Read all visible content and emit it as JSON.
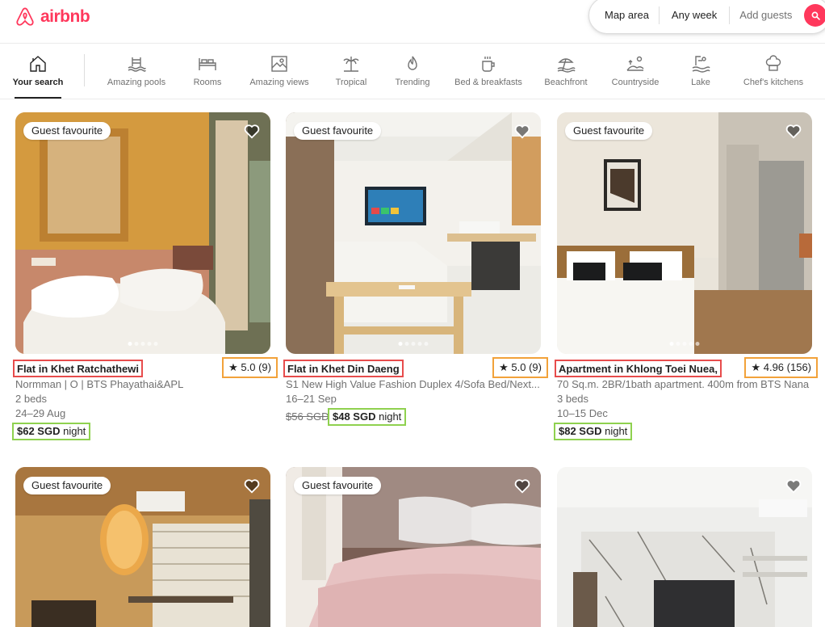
{
  "header": {
    "logo_text": "airbnb",
    "search": {
      "map_label": "Map area",
      "week_label": "Any week",
      "guests_label": "Add guests"
    }
  },
  "categories": [
    {
      "label": "Your search",
      "icon": "home-icon",
      "active": true
    },
    {
      "label": "Amazing pools",
      "icon": "pool-icon",
      "active": false
    },
    {
      "label": "Rooms",
      "icon": "bed-icon",
      "active": false
    },
    {
      "label": "Amazing views",
      "icon": "view-icon",
      "active": false
    },
    {
      "label": "Tropical",
      "icon": "palm-icon",
      "active": false
    },
    {
      "label": "Trending",
      "icon": "flame-icon",
      "active": false
    },
    {
      "label": "Bed & breakfasts",
      "icon": "mug-icon",
      "active": false
    },
    {
      "label": "Beachfront",
      "icon": "beach-icon",
      "active": false
    },
    {
      "label": "Countryside",
      "icon": "countryside-icon",
      "active": false
    },
    {
      "label": "Lake",
      "icon": "lake-icon",
      "active": false
    },
    {
      "label": "Chef's kitchens",
      "icon": "chef-hat-icon",
      "active": false
    }
  ],
  "listings": [
    {
      "badge": "Guest favourite",
      "title": "Flat in Khet Ratchathewi",
      "rating": "★ 5.0 (9)",
      "subtitle": "Normman | O | BTS Phayathai&APL",
      "beds": "2 beds",
      "dates": "24–29 Aug",
      "old_price": "",
      "price": "$62 SGD",
      "price_suffix": " night"
    },
    {
      "badge": "Guest favourite",
      "title": "Flat in Khet Din Daeng",
      "rating": "★ 5.0 (9)",
      "subtitle": "S1 New High Value Fashion Duplex 4/Sofa Bed/Next...",
      "beds": "",
      "dates": "16–21 Sep",
      "old_price": "$56 SGD",
      "price": "$48 SGD",
      "price_suffix": " night"
    },
    {
      "badge": "Guest favourite",
      "title": "Apartment in Khlong Toei Nuea,",
      "rating": "★ 4.96 (156)",
      "subtitle": "70 Sq.m. 2BR/1bath apartment. 400m from BTS Nana",
      "beds": "3 beds",
      "dates": "10–15 Dec",
      "old_price": "",
      "price": "$82 SGD",
      "price_suffix": " night"
    },
    {
      "badge": "Guest favourite"
    },
    {
      "badge": "Guest favourite"
    },
    {
      "badge": ""
    }
  ],
  "colors": {
    "brand": "#ff385c",
    "title_box": "#e74c4c",
    "rating_box": "#f2a23a",
    "price_box": "#8fd14f"
  }
}
